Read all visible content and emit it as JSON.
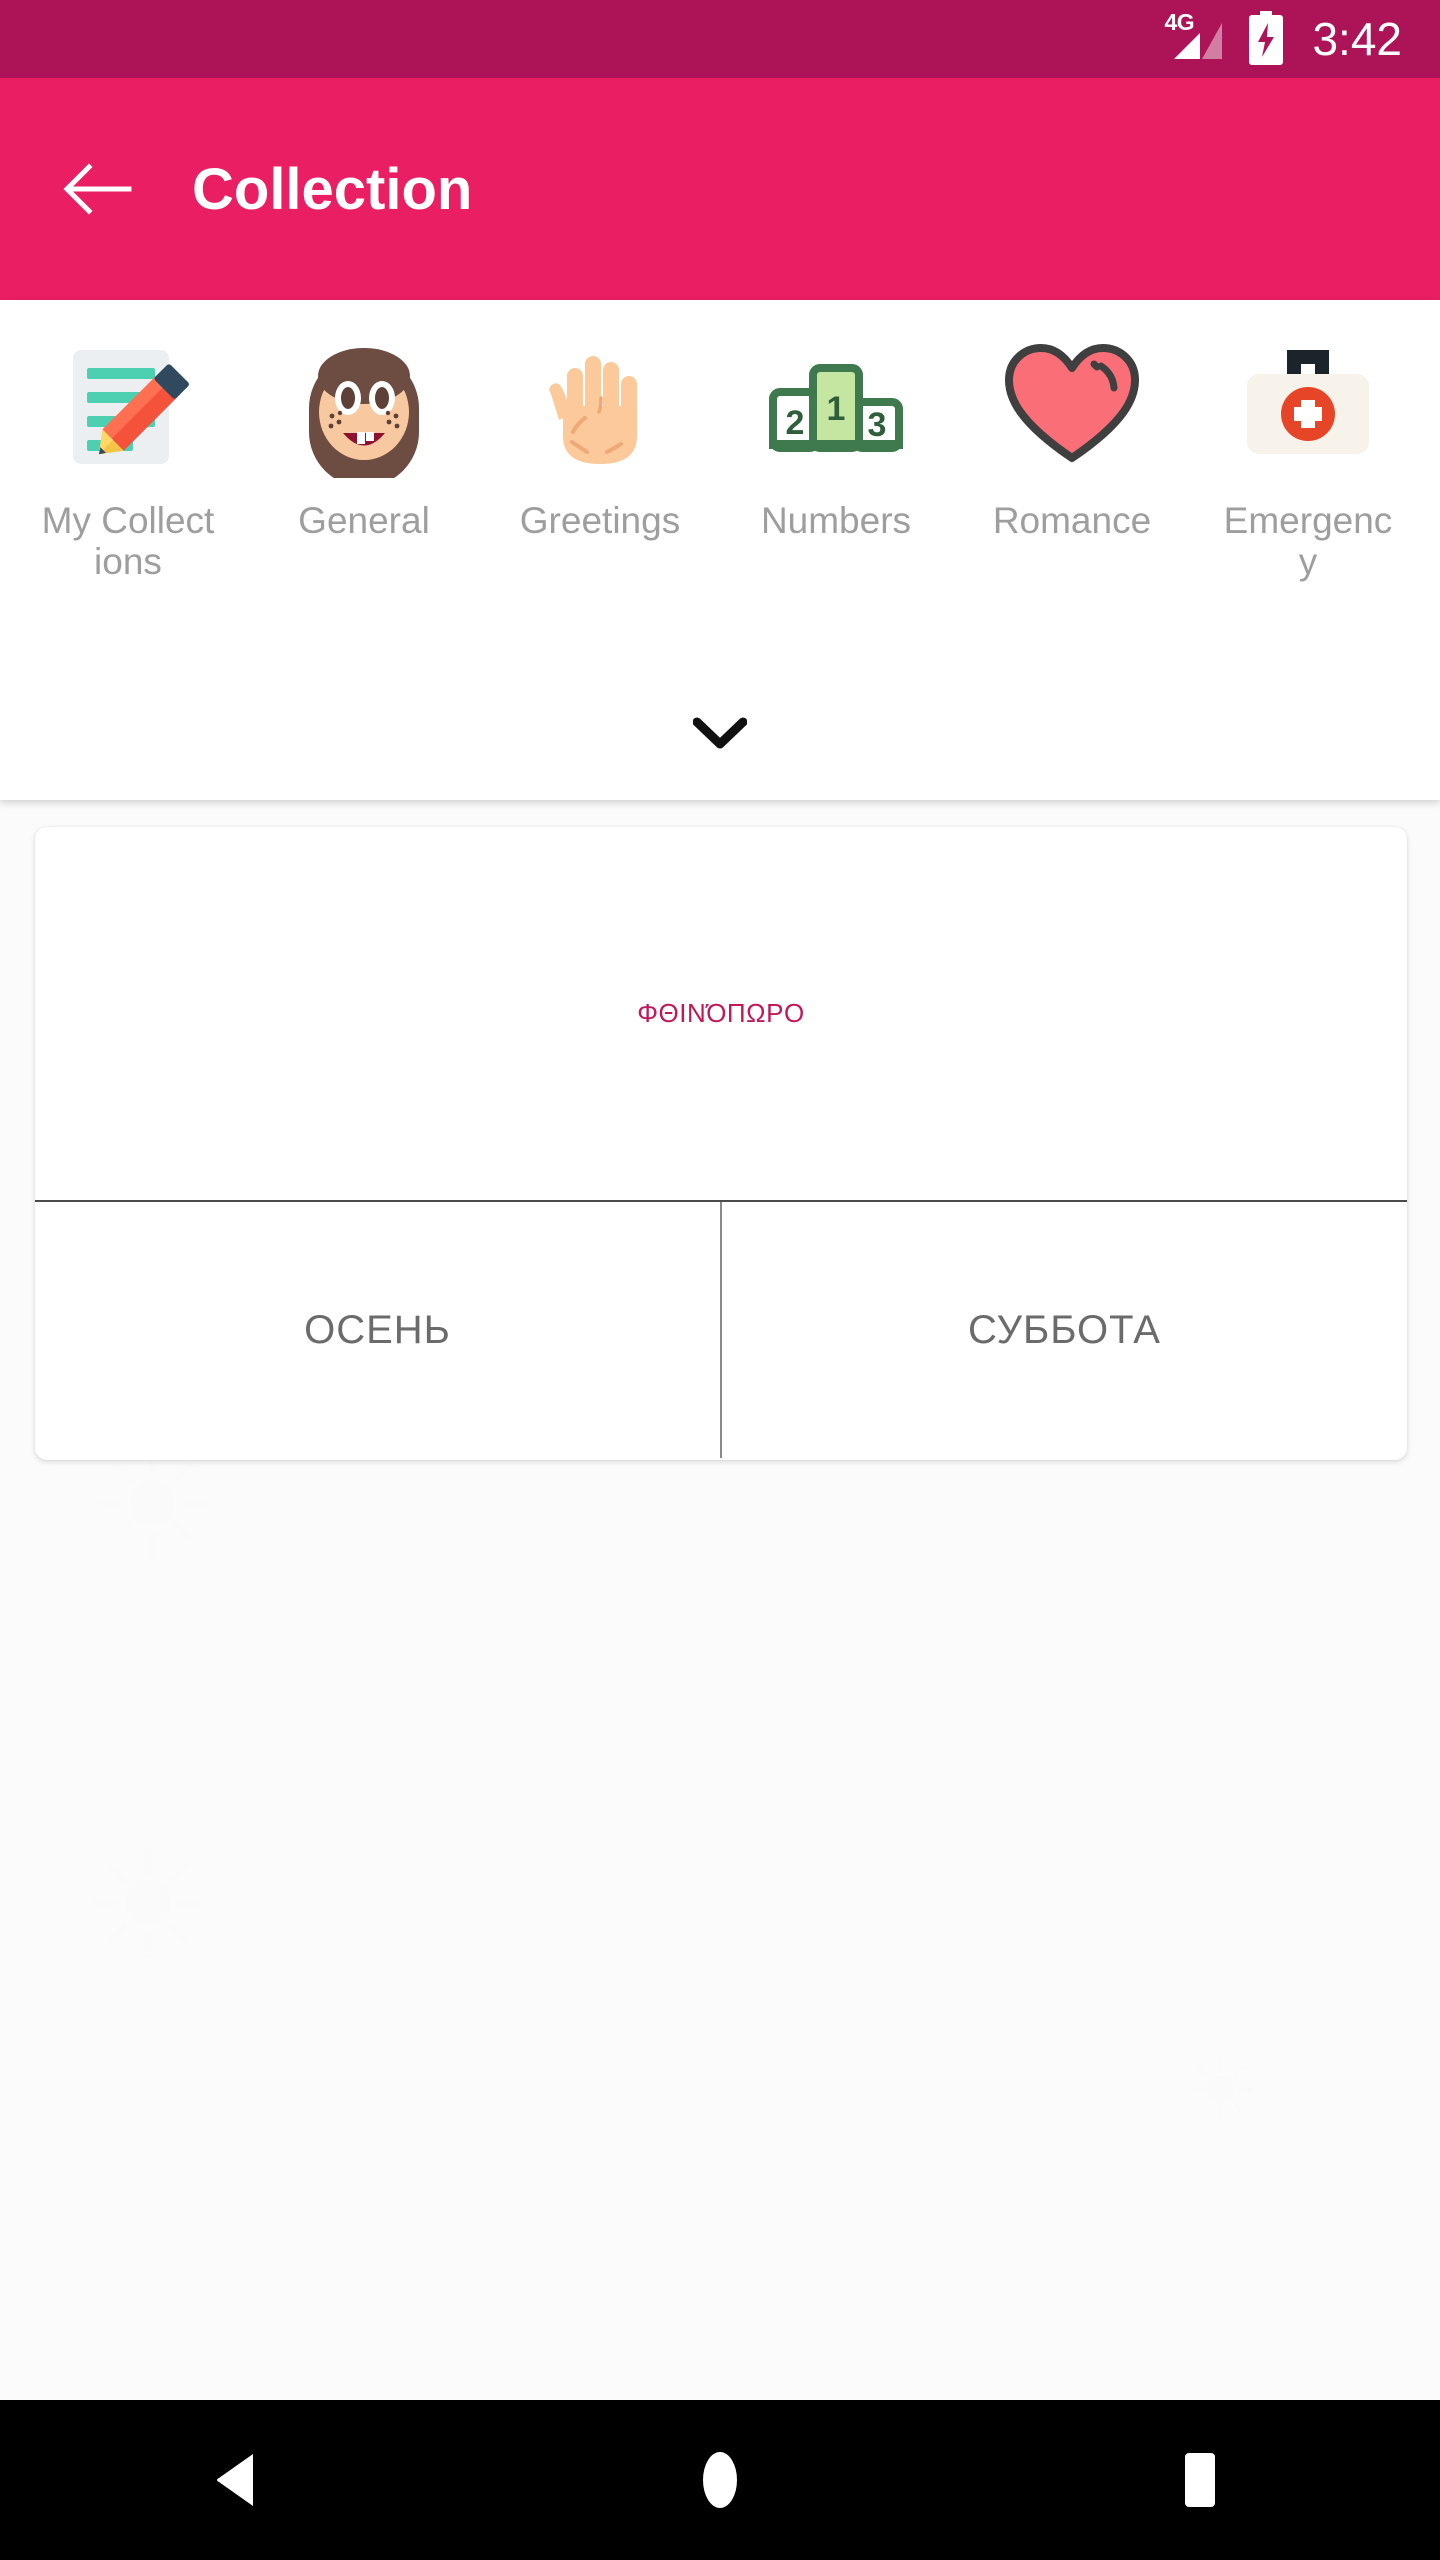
{
  "status_bar": {
    "network_label": "4G",
    "time": "3:42",
    "signal_icon": "signal-bars-icon",
    "battery_icon": "battery-charging-icon",
    "background_color": "#AD1457"
  },
  "app_bar": {
    "title": "Collection",
    "back_icon": "arrow-left-icon",
    "background_color": "#E91E63",
    "text_color": "#FFFFFF"
  },
  "categories": {
    "expand_icon": "chevron-down-icon",
    "items": [
      {
        "label": "My Collections",
        "icon": "memo-pencil-icon"
      },
      {
        "label": "General",
        "icon": "child-face-icon"
      },
      {
        "label": "Greetings",
        "icon": "raised-hand-icon"
      },
      {
        "label": "Numbers",
        "icon": "podium-123-icon"
      },
      {
        "label": "Romance",
        "icon": "heart-icon"
      },
      {
        "label": "Emergency",
        "icon": "first-aid-kit-icon"
      }
    ],
    "label_color": "#9E9E9E"
  },
  "card": {
    "target_word": "ΦΘΙΝΌΠΩΡΟ",
    "target_word_color": "#C2185B",
    "options": [
      {
        "label": "ОСЕНЬ"
      },
      {
        "label": "СУББОТА"
      }
    ],
    "option_color": "#6B6B6B"
  },
  "nav_bar": {
    "back_icon": "triangle-back-icon",
    "home_icon": "circle-home-icon",
    "recents_icon": "square-recents-icon",
    "background_color": "#000000"
  }
}
